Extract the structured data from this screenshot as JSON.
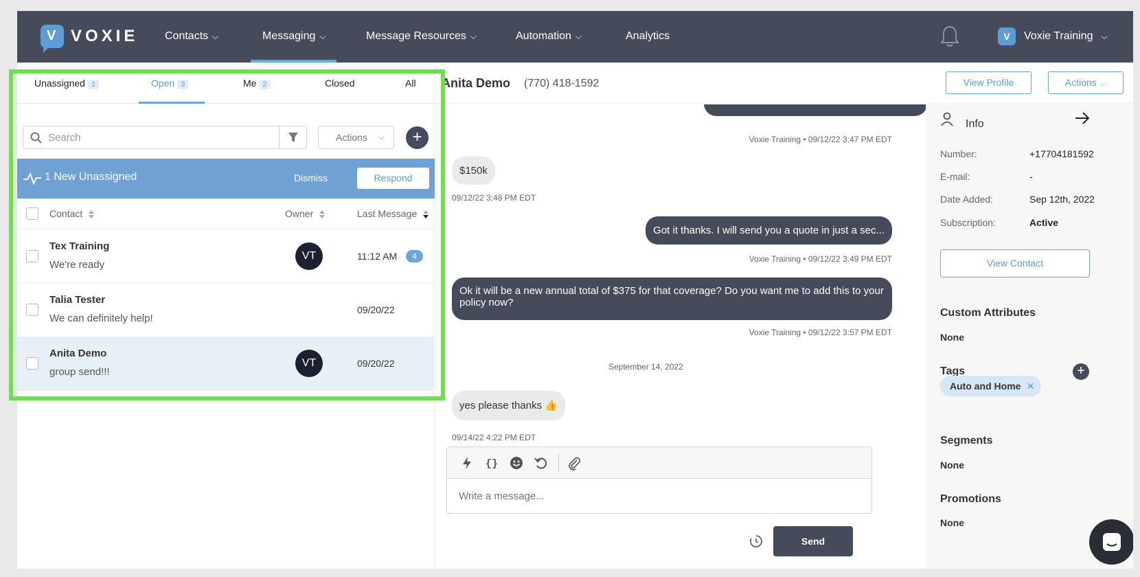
{
  "brand": {
    "name": "VOXIE",
    "logo_letter": "V"
  },
  "nav": {
    "items": [
      {
        "label": "Contacts",
        "has_menu": true
      },
      {
        "label": "Messaging",
        "has_menu": true,
        "active": true
      },
      {
        "label": "Message Resources",
        "has_menu": true
      },
      {
        "label": "Automation",
        "has_menu": true
      },
      {
        "label": "Analytics",
        "has_menu": false
      }
    ],
    "account": "Voxie Training",
    "bell_icon": "bell-icon"
  },
  "inbox": {
    "tabs": [
      {
        "label": "Unassigned",
        "count": "1"
      },
      {
        "label": "Open",
        "count": "3",
        "active": true
      },
      {
        "label": "Me",
        "count": "2"
      },
      {
        "label": "Closed",
        "count": ""
      },
      {
        "label": "All",
        "count": ""
      }
    ],
    "search_placeholder": "Search",
    "actions_label": "Actions",
    "banner": {
      "text": "1 New Unassigned",
      "dismiss": "Dismiss",
      "respond": "Respond"
    },
    "columns": {
      "contact": "Contact",
      "owner": "Owner",
      "last_message": "Last Message"
    },
    "rows": [
      {
        "name": "Tex Training",
        "preview": "We're ready",
        "owner": "VT",
        "time": "11:12 AM",
        "unread": "4"
      },
      {
        "name": "Talia Tester",
        "preview": "We can definitely help!",
        "owner": "",
        "time": "09/20/22",
        "unread": ""
      },
      {
        "name": "Anita Demo",
        "preview": "group send!!!",
        "owner": "VT",
        "time": "09/20/22",
        "unread": "",
        "selected": true
      }
    ]
  },
  "conversation": {
    "contact_name": "Anita Demo",
    "phone": "(770) 418-1592",
    "view_profile": "View Profile",
    "actions": "Actions",
    "messages": [
      {
        "dir": "out",
        "text": "",
        "meta": "Voxie Training • 09/12/22 3:47 PM EDT"
      },
      {
        "dir": "in",
        "text": "$150k",
        "meta": "09/12/22 3:48 PM EDT"
      },
      {
        "dir": "out",
        "text": "Got it thanks. I will send you a quote in just a sec...",
        "meta": "Voxie Training • 09/12/22 3:49 PM EDT"
      },
      {
        "dir": "out",
        "text": "Ok it will be a new annual total of $375 for that coverage? Do you want me to add this to your policy now?",
        "meta": "Voxie Training • 09/12/22 3:57 PM EDT"
      },
      {
        "dir": "in",
        "text": "yes please thanks 👍",
        "meta": "09/14/22 4:22 PM EDT"
      }
    ],
    "date_divider": "September 14, 2022",
    "composer_placeholder": "Write a message...",
    "send_label": "Send"
  },
  "info_panel": {
    "title": "Info",
    "fields": [
      {
        "label": "Number:",
        "value": "+17704181592"
      },
      {
        "label": "E-mail:",
        "value": "-"
      },
      {
        "label": "Date Added:",
        "value": "Sep 12th, 2022"
      },
      {
        "label": "Subscription:",
        "value": "Active"
      }
    ],
    "view_contact": "View Contact",
    "custom_attributes": {
      "title": "Custom Attributes",
      "value": "None"
    },
    "tags": {
      "title": "Tags",
      "items": [
        "Auto and Home"
      ]
    },
    "segments": {
      "title": "Segments",
      "value": "None"
    },
    "promotions": {
      "title": "Promotions",
      "value": "None"
    }
  },
  "colors": {
    "nav_bg": "#454b5b",
    "accent": "#5d9dd6",
    "banner": "#6fa2d3",
    "highlight": "#6ee04e"
  }
}
